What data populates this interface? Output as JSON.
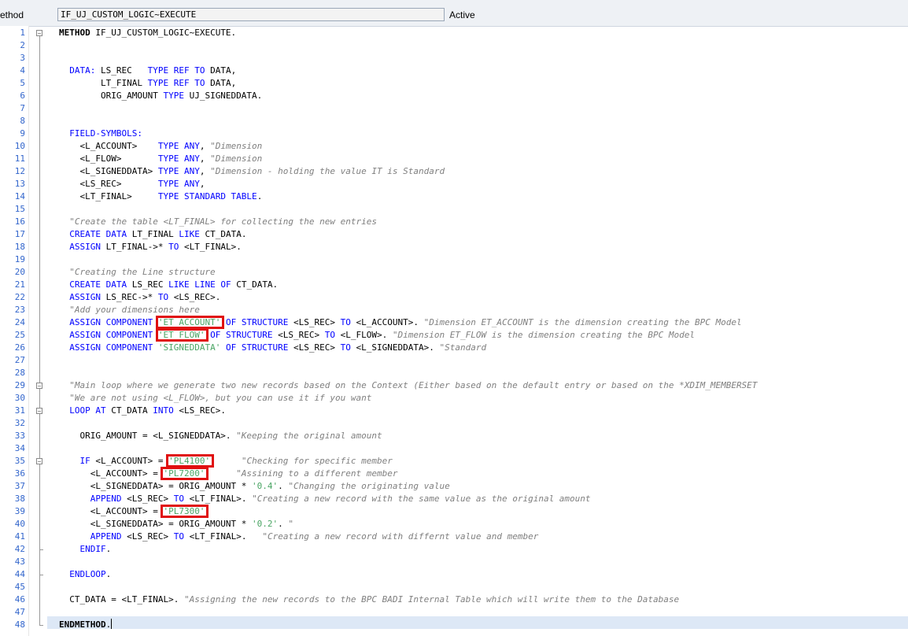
{
  "header": {
    "label": "ethod",
    "method_name": "IF_UJ_CUSTOM_LOGIC~EXECUTE",
    "status": "Active"
  },
  "code": {
    "lines": [
      [
        [
          "b",
          "METHOD"
        ],
        [
          "t",
          " IF_UJ_CUSTOM_LOGIC~EXECUTE."
        ]
      ],
      [],
      [],
      [
        [
          "t",
          "  "
        ],
        [
          "kw",
          "DATA:"
        ],
        [
          "t",
          " LS_REC   "
        ],
        [
          "kw",
          "TYPE REF TO"
        ],
        [
          "t",
          " DATA,"
        ]
      ],
      [
        [
          "t",
          "        LT_FINAL "
        ],
        [
          "kw",
          "TYPE REF TO"
        ],
        [
          "t",
          " DATA,"
        ]
      ],
      [
        [
          "t",
          "        ORIG_AMOUNT "
        ],
        [
          "kw",
          "TYPE"
        ],
        [
          "t",
          " UJ_SIGNEDDATA."
        ]
      ],
      [],
      [],
      [
        [
          "t",
          "  "
        ],
        [
          "kw",
          "FIELD-SYMBOLS:"
        ]
      ],
      [
        [
          "t",
          "    <L_ACCOUNT>    "
        ],
        [
          "kw",
          "TYPE ANY"
        ],
        [
          "t",
          ", "
        ],
        [
          "cm",
          "\"Dimension"
        ]
      ],
      [
        [
          "t",
          "    <L_FLOW>       "
        ],
        [
          "kw",
          "TYPE ANY"
        ],
        [
          "t",
          ", "
        ],
        [
          "cm",
          "\"Dimension"
        ]
      ],
      [
        [
          "t",
          "    <L_SIGNEDDATA> "
        ],
        [
          "kw",
          "TYPE ANY"
        ],
        [
          "t",
          ", "
        ],
        [
          "cm",
          "\"Dimension - holding the value IT is Standard"
        ]
      ],
      [
        [
          "t",
          "    <LS_REC>       "
        ],
        [
          "kw",
          "TYPE ANY"
        ],
        [
          "t",
          ","
        ]
      ],
      [
        [
          "t",
          "    <LT_FINAL>     "
        ],
        [
          "kw",
          "TYPE STANDARD TABLE"
        ],
        [
          "t",
          "."
        ]
      ],
      [],
      [
        [
          "t",
          "  "
        ],
        [
          "cm",
          "\"Create the table <LT_FINAL> for collecting the new entries"
        ]
      ],
      [
        [
          "t",
          "  "
        ],
        [
          "kw",
          "CREATE DATA"
        ],
        [
          "t",
          " LT_FINAL "
        ],
        [
          "kw",
          "LIKE"
        ],
        [
          "t",
          " CT_DATA."
        ]
      ],
      [
        [
          "t",
          "  "
        ],
        [
          "kw",
          "ASSIGN"
        ],
        [
          "t",
          " LT_FINAL->* "
        ],
        [
          "kw",
          "TO"
        ],
        [
          "t",
          " <LT_FINAL>."
        ]
      ],
      [],
      [
        [
          "t",
          "  "
        ],
        [
          "cm",
          "\"Creating the Line structure"
        ]
      ],
      [
        [
          "t",
          "  "
        ],
        [
          "kw",
          "CREATE DATA"
        ],
        [
          "t",
          " LS_REC "
        ],
        [
          "kw",
          "LIKE LINE OF"
        ],
        [
          "t",
          " CT_DATA."
        ]
      ],
      [
        [
          "t",
          "  "
        ],
        [
          "kw",
          "ASSIGN"
        ],
        [
          "t",
          " LS_REC->* "
        ],
        [
          "kw",
          "TO"
        ],
        [
          "t",
          " <LS_REC>."
        ]
      ],
      [
        [
          "t",
          "  "
        ],
        [
          "cm",
          "\"Add your dimensions here"
        ]
      ],
      [
        [
          "t",
          "  "
        ],
        [
          "kw",
          "ASSIGN COMPONENT"
        ],
        [
          "t",
          " "
        ],
        [
          "st",
          "'ET_ACCOUNT'"
        ],
        [
          "t",
          " "
        ],
        [
          "kw",
          "OF STRUCTURE"
        ],
        [
          "t",
          " <LS_REC> "
        ],
        [
          "kw",
          "TO"
        ],
        [
          "t",
          " <L_ACCOUNT>. "
        ],
        [
          "cm",
          "\"Dimension ET_ACCOUNT is the dimension creating the BPC Model"
        ]
      ],
      [
        [
          "t",
          "  "
        ],
        [
          "kw",
          "ASSIGN COMPONENT"
        ],
        [
          "t",
          " "
        ],
        [
          "st",
          "'ET_FLOW'"
        ],
        [
          "t",
          " "
        ],
        [
          "kw",
          "OF STRUCTURE"
        ],
        [
          "t",
          " <LS_REC> "
        ],
        [
          "kw",
          "TO"
        ],
        [
          "t",
          " <L_FLOW>. "
        ],
        [
          "cm",
          "\"Dimension ET_FLOW is the dimension creating the BPC Model"
        ]
      ],
      [
        [
          "t",
          "  "
        ],
        [
          "kw",
          "ASSIGN COMPONENT"
        ],
        [
          "t",
          " "
        ],
        [
          "st",
          "'SIGNEDDATA'"
        ],
        [
          "t",
          " "
        ],
        [
          "kw",
          "OF STRUCTURE"
        ],
        [
          "t",
          " <LS_REC> "
        ],
        [
          "kw",
          "TO"
        ],
        [
          "t",
          " <L_SIGNEDDATA>. "
        ],
        [
          "cm",
          "\"Standard"
        ]
      ],
      [],
      [],
      [
        [
          "t",
          "  "
        ],
        [
          "cm",
          "\"Main loop where we generate two new records based on the Context (Either based on the default entry or based on the *XDIM_MEMBERSET"
        ]
      ],
      [
        [
          "t",
          "  "
        ],
        [
          "cm",
          "\"We are not using <L_FLOW>, but you can use it if you want"
        ]
      ],
      [
        [
          "t",
          "  "
        ],
        [
          "kw",
          "LOOP AT"
        ],
        [
          "t",
          " CT_DATA "
        ],
        [
          "kw",
          "INTO"
        ],
        [
          "t",
          " <LS_REC>."
        ]
      ],
      [],
      [
        [
          "t",
          "    ORIG_AMOUNT = <L_SIGNEDDATA>. "
        ],
        [
          "cm",
          "\"Keeping the original amount"
        ]
      ],
      [],
      [
        [
          "t",
          "    "
        ],
        [
          "kw",
          "IF"
        ],
        [
          "t",
          " <L_ACCOUNT> = "
        ],
        [
          "st",
          "'PL4100'"
        ],
        [
          "t",
          "      "
        ],
        [
          "cm",
          "\"Checking for specific member"
        ]
      ],
      [
        [
          "t",
          "      <L_ACCOUNT> = "
        ],
        [
          "st",
          "'PL7200'"
        ],
        [
          "t",
          ".     "
        ],
        [
          "cm",
          "\"Assining to a different member"
        ]
      ],
      [
        [
          "t",
          "      <L_SIGNEDDATA> = ORIG_AMOUNT * "
        ],
        [
          "st",
          "'0.4'"
        ],
        [
          "t",
          ". "
        ],
        [
          "cm",
          "\"Changing the originating value"
        ]
      ],
      [
        [
          "t",
          "      "
        ],
        [
          "kw",
          "APPEND"
        ],
        [
          "t",
          " <LS_REC> "
        ],
        [
          "kw",
          "TO"
        ],
        [
          "t",
          " <LT_FINAL>. "
        ],
        [
          "cm",
          "\"Creating a new record with the same value as the original amount"
        ]
      ],
      [
        [
          "t",
          "      <L_ACCOUNT> = "
        ],
        [
          "st",
          "'PL7300'"
        ],
        [
          "t",
          "."
        ]
      ],
      [
        [
          "t",
          "      <L_SIGNEDDATA> = ORIG_AMOUNT * "
        ],
        [
          "st",
          "'0.2'"
        ],
        [
          "t",
          ". "
        ],
        [
          "cm",
          "\""
        ]
      ],
      [
        [
          "t",
          "      "
        ],
        [
          "kw",
          "APPEND"
        ],
        [
          "t",
          " <LS_REC> "
        ],
        [
          "kw",
          "TO"
        ],
        [
          "t",
          " <LT_FINAL>.   "
        ],
        [
          "cm",
          "\"Creating a new record with differnt value and member"
        ]
      ],
      [
        [
          "t",
          "    "
        ],
        [
          "kw",
          "ENDIF"
        ],
        [
          "t",
          "."
        ]
      ],
      [],
      [
        [
          "t",
          "  "
        ],
        [
          "kw",
          "ENDLOOP"
        ],
        [
          "t",
          "."
        ]
      ],
      [],
      [
        [
          "t",
          "  CT_DATA = <LT_FINAL>. "
        ],
        [
          "cm",
          "\"Assigning the new records to the BPC BADI Internal Table which will write them to the Database"
        ]
      ],
      [],
      [
        [
          "b",
          "ENDMETHOD"
        ],
        [
          "t",
          "."
        ]
      ]
    ]
  },
  "fold_markers": [
    1,
    29,
    31,
    35
  ],
  "highlighted_literals": [
    "'ET_ACCOUNT'",
    "'ET_FLOW'",
    "'PL4100'",
    "'PL7200'",
    "'PL7300'"
  ]
}
